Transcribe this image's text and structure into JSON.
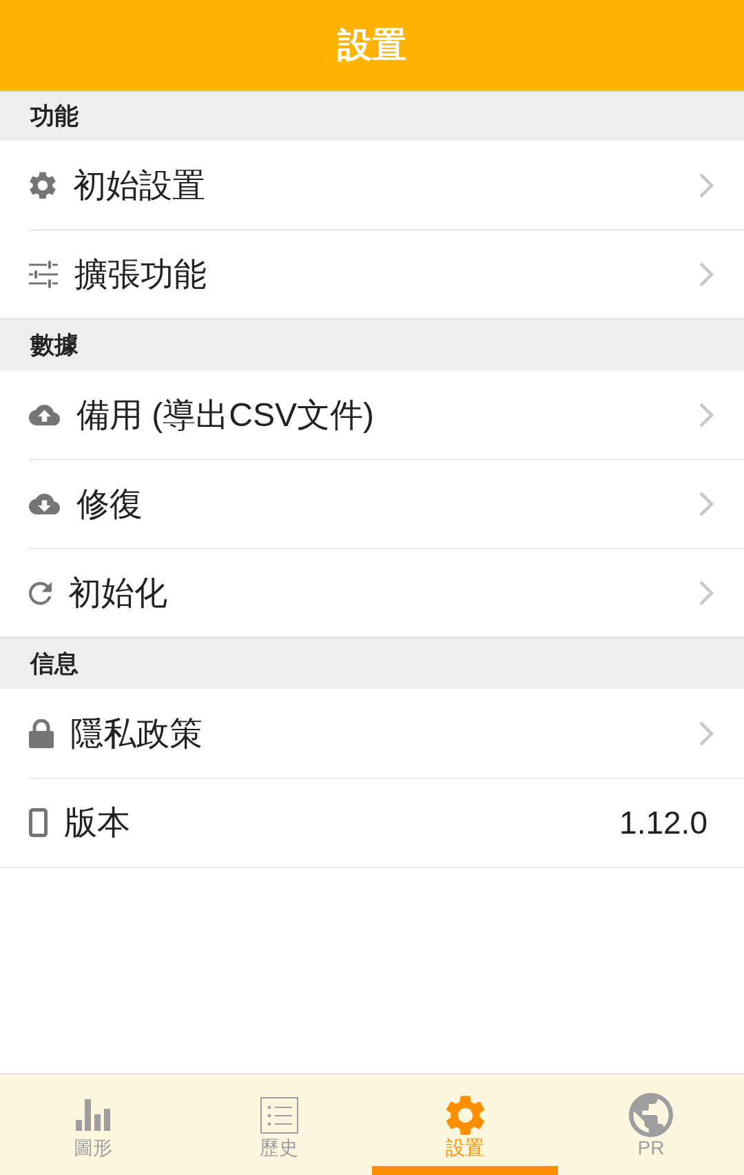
{
  "header": {
    "title": "設置"
  },
  "sections": [
    {
      "title": "功能",
      "items": [
        {
          "kind": "link",
          "label": "初始設置"
        },
        {
          "kind": "link",
          "label": "擴張功能"
        }
      ]
    },
    {
      "title": "數據",
      "items": [
        {
          "kind": "link",
          "label": "備用 (導出CSV文件)"
        },
        {
          "kind": "link",
          "label": "修復"
        },
        {
          "kind": "link",
          "label": "初始化"
        }
      ]
    },
    {
      "title": "信息",
      "items": [
        {
          "kind": "link",
          "label": "隱私政策"
        },
        {
          "kind": "value",
          "label": "版本",
          "value": "1.12.0"
        }
      ]
    }
  ],
  "tabs": [
    {
      "label": "圖形",
      "selected": false
    },
    {
      "label": "歷史",
      "selected": false
    },
    {
      "label": "設置",
      "selected": true
    },
    {
      "label": "PR",
      "selected": false
    }
  ]
}
